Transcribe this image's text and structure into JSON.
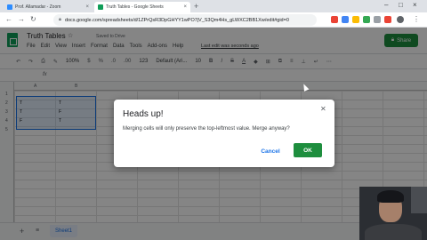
{
  "browser": {
    "tabs": [
      {
        "title": "Prof. Allamadar - Zoom",
        "color": "#2d8cff"
      },
      {
        "title": "Truth Tables - Google Sheets",
        "color": "#0f9d58"
      }
    ],
    "url": "docs.google.com/spreadsheets/d/1ZPrQsR3DpGHYY1wPO7jV_S3Qm4Hs_gLWXC2BB1Xw/edit#gid=0"
  },
  "sheets": {
    "doc_title": "Truth Tables",
    "saved_status": "Saved to Drive",
    "share_label": "Share",
    "last_edit": "Last edit was seconds ago",
    "menu": [
      "File",
      "Edit",
      "View",
      "Insert",
      "Format",
      "Data",
      "Tools",
      "Add-ons",
      "Help"
    ],
    "toolbar": {
      "zoom": "100%",
      "currency": "$",
      "percent": "%",
      "dec1": ".0",
      "dec2": ".00",
      "format": "123",
      "font": "Default (Ari...",
      "font_size": "10",
      "bold": "B",
      "italic": "I",
      "strike": "S",
      "text_color": "A"
    },
    "fx": "fx",
    "columns": [
      "A",
      "B"
    ],
    "rows": [
      "1",
      "2",
      "3",
      "4",
      "5"
    ],
    "cells": {
      "a2": "T",
      "b2": "T",
      "a3": "T",
      "b3": "F",
      "a4": "F",
      "b4": "T"
    },
    "sheet_tab": "Sheet1"
  },
  "dialog": {
    "title": "Heads up!",
    "message": "Merging cells will only preserve the top-leftmost value. Merge anyway?",
    "cancel_label": "Cancel",
    "ok_label": "OK",
    "ok_color": "#1e8e3e"
  }
}
